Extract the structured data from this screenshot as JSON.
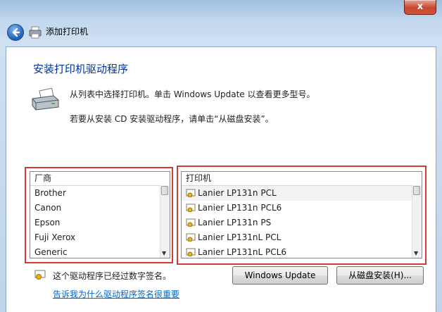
{
  "window": {
    "title": "添加打印机",
    "close_label": "x"
  },
  "page": {
    "heading": "安装打印机驱动程序",
    "description_1": "从列表中选择打印机。单击 Windows Update 以查看更多型号。",
    "description_2": "若要从安装 CD 安装驱动程序，请单击“从磁盘安装”。"
  },
  "manufacturer_list": {
    "header": "厂商",
    "items": [
      "Brother",
      "Canon",
      "Epson",
      "Fuji Xerox",
      "Generic"
    ]
  },
  "printer_list": {
    "header": "打印机",
    "items": [
      "Lanier LP131n PCL",
      "Lanier LP131n PCL6",
      "Lanier LP131n PS",
      "Lanier LP131nL PCL",
      "Lanier LP131nL PCL6"
    ]
  },
  "footer": {
    "signed_text": "这个驱动程序已经过数字签名。",
    "signing_link": "告诉我为什么驱动程序签名很重要",
    "windows_update_button": "Windows Update",
    "have_disk_button": "从磁盘安装(H)..."
  },
  "icons": {
    "back": "back-arrow-icon",
    "printer": "printer-icon",
    "driver": "certified-driver-icon"
  },
  "colors": {
    "heading": "#003399",
    "highlight_border": "#d23a35",
    "link": "#0066cc"
  }
}
